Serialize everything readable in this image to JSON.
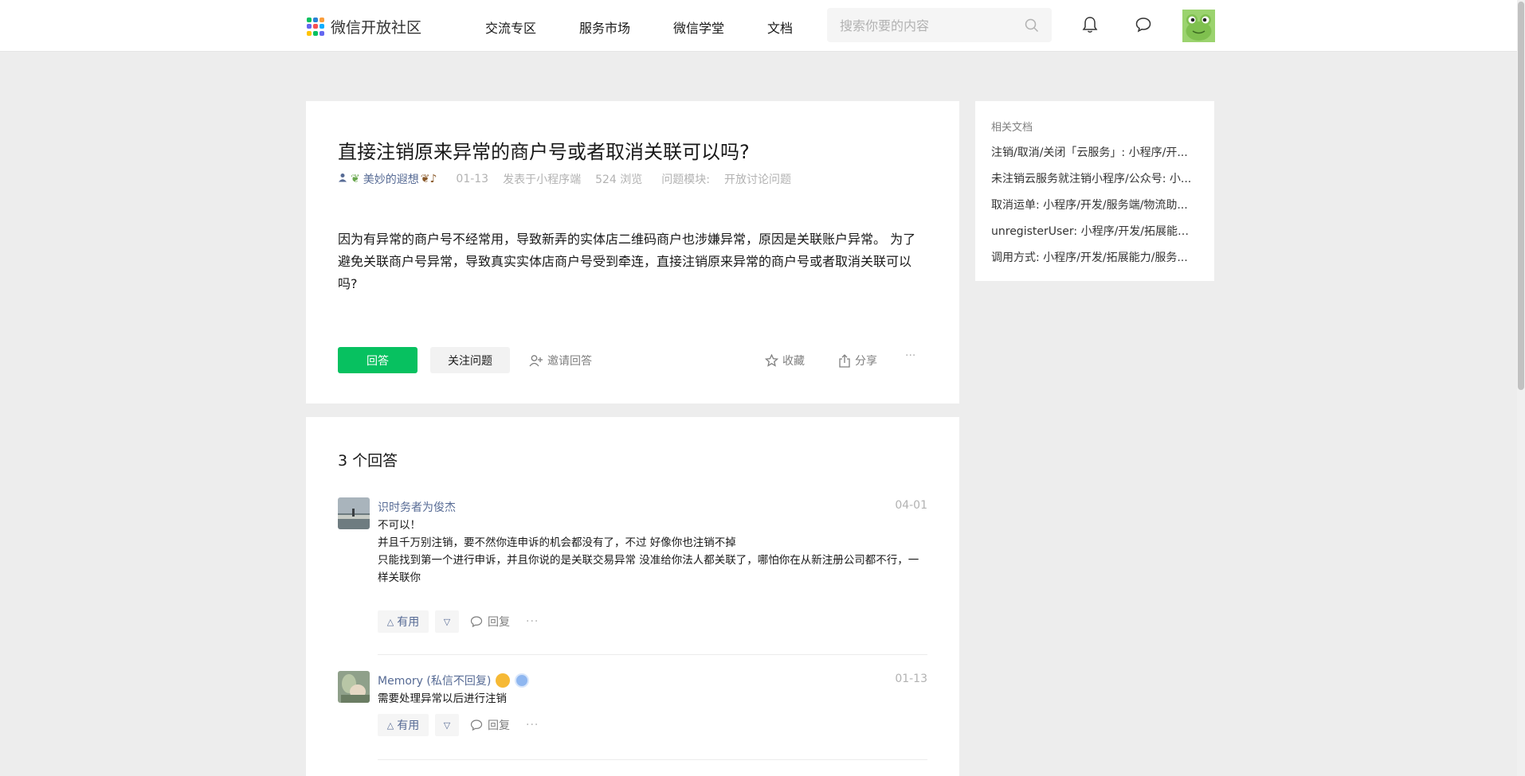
{
  "header": {
    "logo_text": "微信开放社区",
    "nav": [
      "交流专区",
      "服务市场",
      "微信学堂",
      "文档"
    ],
    "search_placeholder": "搜索你要的内容",
    "icons": [
      "bell-icon",
      "message-icon",
      "frog-avatar"
    ]
  },
  "question": {
    "title": "直接注销原来异常的商户号或者取消关联可以吗?",
    "author": "美妙的遐想",
    "date": "01-13",
    "source": "发表于小程序端",
    "views": "524 浏览",
    "module_label": "问题模块:",
    "module_value": "开放讨论问题",
    "body": "因为有异常的商户号不经常用，导致新弄的实体店二维码商户也涉嫌异常，原因是关联账户异常。 为了避免关联商户号异常，导致真实实体店商户号受到牵连，直接注销原来异常的商户号或者取消关联可以吗?",
    "actions": {
      "answer": "回答",
      "follow": "关注问题",
      "invite": "邀请回答",
      "favorite": "收藏",
      "share": "分享",
      "more": "···"
    }
  },
  "sidebar": {
    "title": "相关文档",
    "links": [
      "注销/取消/关闭「云服务」: 小程序/开...",
      "未注销云服务就注销小程序/公众号: 小...",
      "取消运单: 小程序/开发/服务端/物流助...",
      "unregisterUser: 小程序/开发/拓展能力...",
      "调用方式: 小程序/开发/拓展能力/服务..."
    ]
  },
  "answers": {
    "count_label": "3 个回答",
    "items": [
      {
        "name": "识时务者为俊杰",
        "date": "04-01",
        "lines": [
          "不可以！",
          "并且千万别注销，要不然你连申诉的机会都没有了，不过 好像你也注销不掉",
          "只能找到第一个进行申诉，并且你说的是关联交易异常 没准给你法人都关联了，哪怕你在从新注册公司都不行，一样关联你"
        ],
        "useful": "有用",
        "reply": "回复",
        "more": "···"
      },
      {
        "name": "Memory (私信不回复)",
        "date": "01-13",
        "lines": [
          "需要处理异常以后进行注销"
        ],
        "useful": "有用",
        "reply": "回复",
        "more": "···"
      }
    ]
  },
  "colors": {
    "brand_green": "#07c160",
    "link_blue": "#576b95",
    "page_bg": "#ededed"
  }
}
